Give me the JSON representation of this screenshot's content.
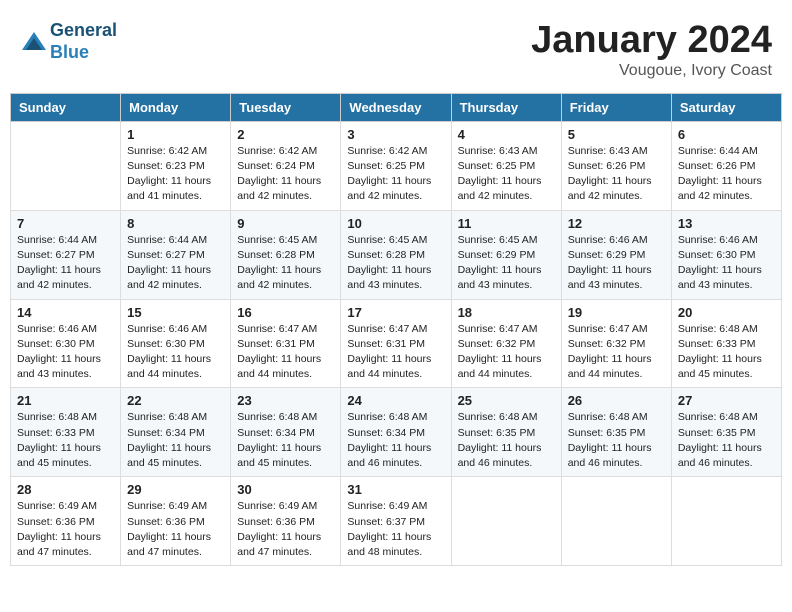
{
  "header": {
    "logo_line1": "General",
    "logo_line2": "Blue",
    "month_year": "January 2024",
    "location": "Vougoue, Ivory Coast"
  },
  "weekdays": [
    "Sunday",
    "Monday",
    "Tuesday",
    "Wednesday",
    "Thursday",
    "Friday",
    "Saturday"
  ],
  "weeks": [
    [
      {
        "day": "",
        "sunrise": "",
        "sunset": "",
        "daylight": ""
      },
      {
        "day": "1",
        "sunrise": "Sunrise: 6:42 AM",
        "sunset": "Sunset: 6:23 PM",
        "daylight": "Daylight: 11 hours and 41 minutes."
      },
      {
        "day": "2",
        "sunrise": "Sunrise: 6:42 AM",
        "sunset": "Sunset: 6:24 PM",
        "daylight": "Daylight: 11 hours and 42 minutes."
      },
      {
        "day": "3",
        "sunrise": "Sunrise: 6:42 AM",
        "sunset": "Sunset: 6:25 PM",
        "daylight": "Daylight: 11 hours and 42 minutes."
      },
      {
        "day": "4",
        "sunrise": "Sunrise: 6:43 AM",
        "sunset": "Sunset: 6:25 PM",
        "daylight": "Daylight: 11 hours and 42 minutes."
      },
      {
        "day": "5",
        "sunrise": "Sunrise: 6:43 AM",
        "sunset": "Sunset: 6:26 PM",
        "daylight": "Daylight: 11 hours and 42 minutes."
      },
      {
        "day": "6",
        "sunrise": "Sunrise: 6:44 AM",
        "sunset": "Sunset: 6:26 PM",
        "daylight": "Daylight: 11 hours and 42 minutes."
      }
    ],
    [
      {
        "day": "7",
        "sunrise": "Sunrise: 6:44 AM",
        "sunset": "Sunset: 6:27 PM",
        "daylight": "Daylight: 11 hours and 42 minutes."
      },
      {
        "day": "8",
        "sunrise": "Sunrise: 6:44 AM",
        "sunset": "Sunset: 6:27 PM",
        "daylight": "Daylight: 11 hours and 42 minutes."
      },
      {
        "day": "9",
        "sunrise": "Sunrise: 6:45 AM",
        "sunset": "Sunset: 6:28 PM",
        "daylight": "Daylight: 11 hours and 42 minutes."
      },
      {
        "day": "10",
        "sunrise": "Sunrise: 6:45 AM",
        "sunset": "Sunset: 6:28 PM",
        "daylight": "Daylight: 11 hours and 43 minutes."
      },
      {
        "day": "11",
        "sunrise": "Sunrise: 6:45 AM",
        "sunset": "Sunset: 6:29 PM",
        "daylight": "Daylight: 11 hours and 43 minutes."
      },
      {
        "day": "12",
        "sunrise": "Sunrise: 6:46 AM",
        "sunset": "Sunset: 6:29 PM",
        "daylight": "Daylight: 11 hours and 43 minutes."
      },
      {
        "day": "13",
        "sunrise": "Sunrise: 6:46 AM",
        "sunset": "Sunset: 6:30 PM",
        "daylight": "Daylight: 11 hours and 43 minutes."
      }
    ],
    [
      {
        "day": "14",
        "sunrise": "Sunrise: 6:46 AM",
        "sunset": "Sunset: 6:30 PM",
        "daylight": "Daylight: 11 hours and 43 minutes."
      },
      {
        "day": "15",
        "sunrise": "Sunrise: 6:46 AM",
        "sunset": "Sunset: 6:30 PM",
        "daylight": "Daylight: 11 hours and 44 minutes."
      },
      {
        "day": "16",
        "sunrise": "Sunrise: 6:47 AM",
        "sunset": "Sunset: 6:31 PM",
        "daylight": "Daylight: 11 hours and 44 minutes."
      },
      {
        "day": "17",
        "sunrise": "Sunrise: 6:47 AM",
        "sunset": "Sunset: 6:31 PM",
        "daylight": "Daylight: 11 hours and 44 minutes."
      },
      {
        "day": "18",
        "sunrise": "Sunrise: 6:47 AM",
        "sunset": "Sunset: 6:32 PM",
        "daylight": "Daylight: 11 hours and 44 minutes."
      },
      {
        "day": "19",
        "sunrise": "Sunrise: 6:47 AM",
        "sunset": "Sunset: 6:32 PM",
        "daylight": "Daylight: 11 hours and 44 minutes."
      },
      {
        "day": "20",
        "sunrise": "Sunrise: 6:48 AM",
        "sunset": "Sunset: 6:33 PM",
        "daylight": "Daylight: 11 hours and 45 minutes."
      }
    ],
    [
      {
        "day": "21",
        "sunrise": "Sunrise: 6:48 AM",
        "sunset": "Sunset: 6:33 PM",
        "daylight": "Daylight: 11 hours and 45 minutes."
      },
      {
        "day": "22",
        "sunrise": "Sunrise: 6:48 AM",
        "sunset": "Sunset: 6:34 PM",
        "daylight": "Daylight: 11 hours and 45 minutes."
      },
      {
        "day": "23",
        "sunrise": "Sunrise: 6:48 AM",
        "sunset": "Sunset: 6:34 PM",
        "daylight": "Daylight: 11 hours and 45 minutes."
      },
      {
        "day": "24",
        "sunrise": "Sunrise: 6:48 AM",
        "sunset": "Sunset: 6:34 PM",
        "daylight": "Daylight: 11 hours and 46 minutes."
      },
      {
        "day": "25",
        "sunrise": "Sunrise: 6:48 AM",
        "sunset": "Sunset: 6:35 PM",
        "daylight": "Daylight: 11 hours and 46 minutes."
      },
      {
        "day": "26",
        "sunrise": "Sunrise: 6:48 AM",
        "sunset": "Sunset: 6:35 PM",
        "daylight": "Daylight: 11 hours and 46 minutes."
      },
      {
        "day": "27",
        "sunrise": "Sunrise: 6:48 AM",
        "sunset": "Sunset: 6:35 PM",
        "daylight": "Daylight: 11 hours and 46 minutes."
      }
    ],
    [
      {
        "day": "28",
        "sunrise": "Sunrise: 6:49 AM",
        "sunset": "Sunset: 6:36 PM",
        "daylight": "Daylight: 11 hours and 47 minutes."
      },
      {
        "day": "29",
        "sunrise": "Sunrise: 6:49 AM",
        "sunset": "Sunset: 6:36 PM",
        "daylight": "Daylight: 11 hours and 47 minutes."
      },
      {
        "day": "30",
        "sunrise": "Sunrise: 6:49 AM",
        "sunset": "Sunset: 6:36 PM",
        "daylight": "Daylight: 11 hours and 47 minutes."
      },
      {
        "day": "31",
        "sunrise": "Sunrise: 6:49 AM",
        "sunset": "Sunset: 6:37 PM",
        "daylight": "Daylight: 11 hours and 48 minutes."
      },
      {
        "day": "",
        "sunrise": "",
        "sunset": "",
        "daylight": ""
      },
      {
        "day": "",
        "sunrise": "",
        "sunset": "",
        "daylight": ""
      },
      {
        "day": "",
        "sunrise": "",
        "sunset": "",
        "daylight": ""
      }
    ]
  ]
}
